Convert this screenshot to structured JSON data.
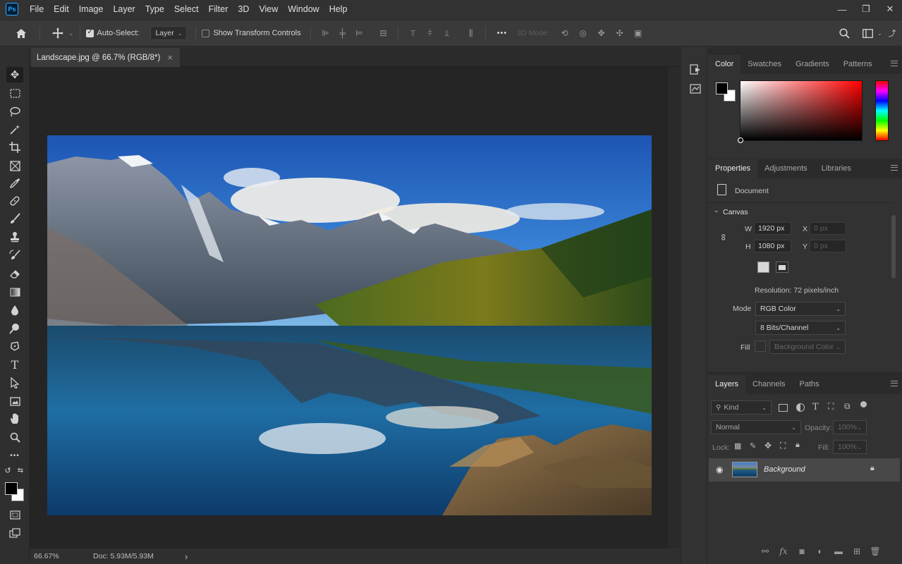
{
  "app": {
    "logo": "Ps"
  },
  "menu": [
    "File",
    "Edit",
    "Image",
    "Layer",
    "Type",
    "Select",
    "Filter",
    "3D",
    "View",
    "Window",
    "Help"
  ],
  "window_controls": {
    "minimize": "—",
    "restore": "❐",
    "close": "✕"
  },
  "options": {
    "auto_select_label": "Auto-Select:",
    "auto_select_value": "Layer",
    "transform_label": "Show Transform Controls",
    "mode_3d_label": "3D Mode:",
    "more": "•••"
  },
  "document": {
    "tab_title": "Landscape.jpg @ 66.7% (RGB/8*)",
    "close": "×"
  },
  "status": {
    "zoom": "66.67%",
    "doc": "Doc: 5.93M/5.93M",
    "arrow": "›"
  },
  "color_panel": {
    "tabs": [
      "Color",
      "Swatches",
      "Gradients",
      "Patterns"
    ],
    "fg": "#000000",
    "bg": "#ffffff",
    "hue": "#ff0000"
  },
  "properties": {
    "tabs": [
      "Properties",
      "Adjustments",
      "Libraries"
    ],
    "doc_label": "Document",
    "section": "Canvas",
    "w_label": "W",
    "w_value": "1920 px",
    "h_label": "H",
    "h_value": "1080 px",
    "x_label": "X",
    "x_value": "0 px",
    "y_label": "Y",
    "y_value": "0 px",
    "resolution": "Resolution: 72 pixels/inch",
    "mode_label": "Mode",
    "mode_value": "RGB Color",
    "bits_value": "8 Bits/Channel",
    "fill_label": "Fill",
    "fill_value": "Background Color"
  },
  "layers": {
    "tabs": [
      "Layers",
      "Channels",
      "Paths"
    ],
    "kind_label": "Kind",
    "blend_mode": "Normal",
    "opacity_label": "Opacity:",
    "opacity_value": "100%",
    "lock_label": "Lock:",
    "fill_label": "Fill:",
    "fill_value": "100%",
    "items": [
      {
        "name": "Background",
        "visible": true,
        "locked": true
      }
    ],
    "bottom_icons": [
      "link-icon",
      "fx-icon",
      "mask-icon",
      "adjustment-icon",
      "folder-icon",
      "new-layer-icon",
      "trash-icon"
    ],
    "fx_text": "fx"
  }
}
